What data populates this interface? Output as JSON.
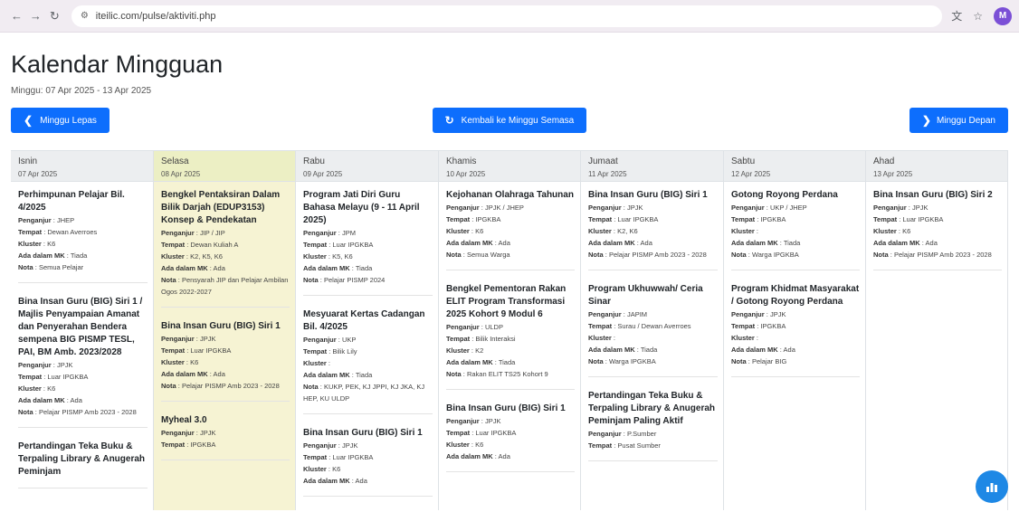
{
  "browser": {
    "url": "iteilic.com/pulse/aktiviti.php",
    "profile_initial": "M"
  },
  "page": {
    "title": "Kalendar Mingguan",
    "week_range": "Minggu: 07 Apr 2025 - 13 Apr 2025",
    "prev_label": "Minggu Lepas",
    "current_label": "Kembali ke Minggu Semasa",
    "next_label": "Minggu Depan"
  },
  "days": [
    {
      "name": "Isnin",
      "date": "07 Apr 2025",
      "width": 158,
      "events": [
        {
          "title": "Perhimpunan Pelajar Bil. 4/2025",
          "lines": [
            [
              "Penganjur",
              "JHEP"
            ],
            [
              "Tempat",
              "Dewan Averroes"
            ],
            [
              "Kluster",
              "K6"
            ],
            [
              "Ada dalam MK",
              "Tiada"
            ],
            [
              "Nota",
              "Semua Pelajar"
            ]
          ]
        },
        {
          "title": "Bina Insan Guru (BIG) Siri 1 / Majlis Penyampaian Amanat dan Penyerahan Bendera sempena BIG PISMP TESL, PAI, BM Amb. 2023/2028",
          "lines": [
            [
              "Penganjur",
              "JPJK"
            ],
            [
              "Tempat",
              "Luar IPGKBA"
            ],
            [
              "Kluster",
              "K6"
            ],
            [
              "Ada dalam MK",
              "Ada"
            ],
            [
              "Nota",
              "Pelajar PISMP Amb 2023 - 2028"
            ]
          ]
        },
        {
          "title": "Pertandingan Teka Buku & Terpaling Library & Anugerah Peminjam",
          "lines": []
        }
      ]
    },
    {
      "name": "Selasa",
      "date": "08 Apr 2025",
      "width": 157,
      "today": true,
      "events": [
        {
          "title": "Bengkel Pentaksiran Dalam Bilik Darjah (EDUP3153) Konsep & Pendekatan",
          "lines": [
            [
              "Penganjur",
              "JIP / JIP"
            ],
            [
              "Tempat",
              "Dewan Kuliah A"
            ],
            [
              "Kluster",
              "K2, K5, K6"
            ],
            [
              "Ada dalam MK",
              "Ada"
            ],
            [
              "Nota",
              "Pensyarah JIP dan Pelajar Ambilan Ogos 2022-2027"
            ]
          ]
        },
        {
          "title": "Bina Insan Guru (BIG) Siri 1",
          "lines": [
            [
              "Penganjur",
              "JPJK"
            ],
            [
              "Tempat",
              "Luar IPGKBA"
            ],
            [
              "Kluster",
              "K6"
            ],
            [
              "Ada dalam MK",
              "Ada"
            ],
            [
              "Nota",
              "Pelajar PISMP Amb 2023 - 2028"
            ]
          ]
        },
        {
          "title": "Myheal 3.0",
          "lines": [
            [
              "Penganjur",
              "JPJK"
            ],
            [
              "Tempat",
              "IPGKBA"
            ]
          ]
        }
      ]
    },
    {
      "name": "Rabu",
      "date": "09 Apr 2025",
      "width": 158,
      "events": [
        {
          "title": "Program Jati Diri Guru Bahasa Melayu (9 - 11 April 2025)",
          "lines": [
            [
              "Penganjur",
              "JPM"
            ],
            [
              "Tempat",
              "Luar IPGKBA"
            ],
            [
              "Kluster",
              "K5, K6"
            ],
            [
              "Ada dalam MK",
              "Tiada"
            ],
            [
              "Nota",
              "Pelajar PISMP 2024"
            ]
          ]
        },
        {
          "title": "Mesyuarat Kertas Cadangan Bil. 4/2025",
          "lines": [
            [
              "Penganjur",
              "UKP"
            ],
            [
              "Tempat",
              "Bilik Lily"
            ],
            [
              "Kluster",
              ""
            ],
            [
              "Ada dalam MK",
              "Tiada"
            ],
            [
              "Nota",
              "KUKP, PEK, KJ JPPI, KJ JKA, KJ HEP, KU ULDP"
            ]
          ]
        },
        {
          "title": "Bina Insan Guru (BIG) Siri 1",
          "lines": [
            [
              "Penganjur",
              "JPJK"
            ],
            [
              "Tempat",
              "Luar IPGKBA"
            ],
            [
              "Kluster",
              "K6"
            ],
            [
              "Ada dalam MK",
              "Ada"
            ]
          ]
        }
      ]
    },
    {
      "name": "Khamis",
      "date": "10 Apr 2025",
      "width": 157,
      "events": [
        {
          "title": "Kejohanan Olahraga Tahunan",
          "lines": [
            [
              "Penganjur",
              "JPJK / JHEP"
            ],
            [
              "Tempat",
              "IPGKBA"
            ],
            [
              "Kluster",
              "K6"
            ],
            [
              "Ada dalam MK",
              "Ada"
            ],
            [
              "Nota",
              "Semua Warga"
            ]
          ]
        },
        {
          "title": "Bengkel Pementoran Rakan ELIT Program Transformasi 2025 Kohort 9 Modul 6",
          "lines": [
            [
              "Penganjur",
              "ULDP"
            ],
            [
              "Tempat",
              "Bilik Interaksi"
            ],
            [
              "Kluster",
              "K2"
            ],
            [
              "Ada dalam MK",
              "Tiada"
            ],
            [
              "Nota",
              "Rakan ELIT TS25 Kohort 9"
            ]
          ]
        },
        {
          "title": "Bina Insan Guru (BIG) Siri 1",
          "lines": [
            [
              "Penganjur",
              "JPJK"
            ],
            [
              "Tempat",
              "Luar IPGKBA"
            ],
            [
              "Kluster",
              "K6"
            ],
            [
              "Ada dalam MK",
              "Ada"
            ]
          ]
        }
      ]
    },
    {
      "name": "Jumaat",
      "date": "11 Apr 2025",
      "width": 158,
      "events": [
        {
          "title": "Bina Insan Guru (BIG) Siri 1",
          "lines": [
            [
              "Penganjur",
              "JPJK"
            ],
            [
              "Tempat",
              "Luar IPGKBA"
            ],
            [
              "Kluster",
              "K2, K6"
            ],
            [
              "Ada dalam MK",
              "Ada"
            ],
            [
              "Nota",
              "Pelajar PISMP Amb 2023 - 2028"
            ]
          ]
        },
        {
          "title": "Program Ukhuwwah/ Ceria Sinar",
          "lines": [
            [
              "Penganjur",
              "JAPIM"
            ],
            [
              "Tempat",
              "Surau / Dewan Averroes"
            ],
            [
              "Kluster",
              ""
            ],
            [
              "Ada dalam MK",
              "Tiada"
            ],
            [
              "Nota",
              "Warga IPGKBA"
            ]
          ]
        },
        {
          "title": "Pertandingan Teka Buku & Terpaling Library & Anugerah Peminjam Paling Aktif",
          "lines": [
            [
              "Penganjur",
              "P.Sumber"
            ],
            [
              "Tempat",
              "Pusat Sumber"
            ]
          ]
        }
      ]
    },
    {
      "name": "Sabtu",
      "date": "12 Apr 2025",
      "width": 157,
      "events": [
        {
          "title": "Gotong Royong Perdana",
          "lines": [
            [
              "Penganjur",
              "UKP / JHEP"
            ],
            [
              "Tempat",
              "IPGKBA"
            ],
            [
              "Kluster",
              ""
            ],
            [
              "Ada dalam MK",
              "Tiada"
            ],
            [
              "Nota",
              "Warga IPGKBA"
            ]
          ]
        },
        {
          "title": "Program Khidmat Masyarakat / Gotong Royong Perdana",
          "lines": [
            [
              "Penganjur",
              "JPJK"
            ],
            [
              "Tempat",
              "IPGKBA"
            ],
            [
              "Kluster",
              ""
            ],
            [
              "Ada dalam MK",
              "Ada"
            ],
            [
              "Nota",
              "Pelajar BIG"
            ]
          ]
        }
      ]
    },
    {
      "name": "Ahad",
      "date": "13 Apr 2025",
      "width": 157,
      "events": [
        {
          "title": "Bina Insan Guru (BIG) Siri 2",
          "lines": [
            [
              "Penganjur",
              "JPJK"
            ],
            [
              "Tempat",
              "Luar IPGKBA"
            ],
            [
              "Kluster",
              "K6"
            ],
            [
              "Ada dalam MK",
              "Ada"
            ],
            [
              "Nota",
              "Pelajar PISMP Amb 2023 - 2028"
            ]
          ]
        }
      ]
    }
  ],
  "icons": {
    "back": "arrow-left-icon",
    "forward": "arrow-right-icon",
    "reload": "reload-icon",
    "site": "site-info-icon",
    "translate": "translate-icon",
    "star": "star-icon",
    "chart_fab": "bar-chart-icon"
  },
  "colors": {
    "primary": "#0d6efd",
    "today_bg": "#f6f3d3",
    "fab": "#1e88e5"
  }
}
